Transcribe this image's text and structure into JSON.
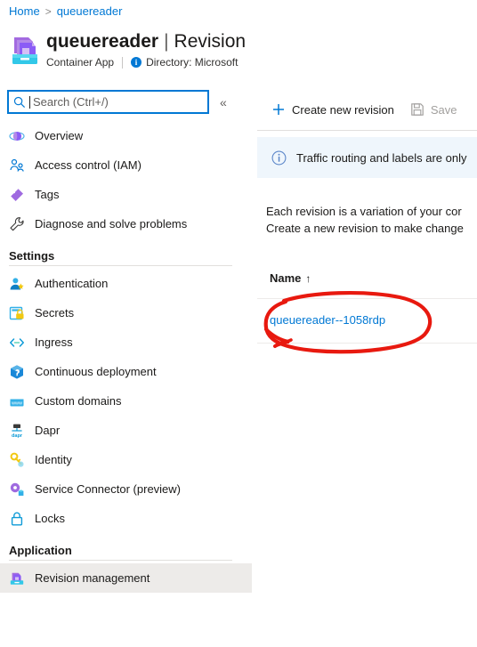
{
  "breadcrumb": {
    "items": [
      "Home",
      "queuereader"
    ],
    "separator": ">"
  },
  "header": {
    "resource_name": "queuereader",
    "pipe": "|",
    "page_title": "Revision management",
    "resource_type": "Container App",
    "directory_label": "Directory: Microsoft",
    "info_glyph": "i",
    "more_menu": "⋯",
    "icon": "container-app-icon"
  },
  "search": {
    "placeholder": "Search (Ctrl+/)",
    "value": "",
    "icon": "search-icon",
    "collapse_icon": "«"
  },
  "sidebar": {
    "top_items": [
      {
        "label": "Overview",
        "icon": "overview-icon"
      },
      {
        "label": "Access control (IAM)",
        "icon": "access-control-icon"
      },
      {
        "label": "Tags",
        "icon": "tags-icon"
      },
      {
        "label": "Diagnose and solve problems",
        "icon": "wrench-icon"
      }
    ],
    "settings_group": "Settings",
    "settings_items": [
      {
        "label": "Authentication",
        "icon": "authentication-icon"
      },
      {
        "label": "Secrets",
        "icon": "secrets-icon"
      },
      {
        "label": "Ingress",
        "icon": "ingress-icon"
      },
      {
        "label": "Continuous deployment",
        "icon": "continuous-deployment-icon"
      },
      {
        "label": "Custom domains",
        "icon": "custom-domains-icon"
      },
      {
        "label": "Dapr",
        "icon": "dapr-icon"
      },
      {
        "label": "Identity",
        "icon": "identity-key-icon"
      },
      {
        "label": "Service Connector (preview)",
        "icon": "service-connector-icon"
      },
      {
        "label": "Locks",
        "icon": "lock-icon"
      }
    ],
    "application_group": "Application",
    "application_items": [
      {
        "label": "Revision management",
        "icon": "revision-management-icon",
        "selected": true
      }
    ]
  },
  "main": {
    "toolbar": {
      "create_label": "Create new revision",
      "create_icon": "plus-icon",
      "save_label": "Save",
      "save_icon": "save-disk-icon",
      "save_disabled": true
    },
    "banner": {
      "icon": "info-circle-icon",
      "text": "Traffic routing and labels are only"
    },
    "description_line1": "Each revision is a variation of your cor",
    "description_line2": "Create a new revision to make change",
    "table": {
      "columns": [
        "Name"
      ],
      "sort_indicator": "↑",
      "rows": [
        {
          "name": "queuereader--1058rdp"
        }
      ]
    }
  },
  "annotation": {
    "shape": "red-ellipse-highlight",
    "color": "#e8190f",
    "target": "queuereader--1058rdp"
  },
  "colors": {
    "accent": "#0078d4",
    "link": "#0078d4",
    "banner_bg": "#eff6fc",
    "selected_bg": "#edebe9",
    "annotation_red": "#e8190f",
    "text": "#1b1a19",
    "muted": "#605e5c"
  }
}
